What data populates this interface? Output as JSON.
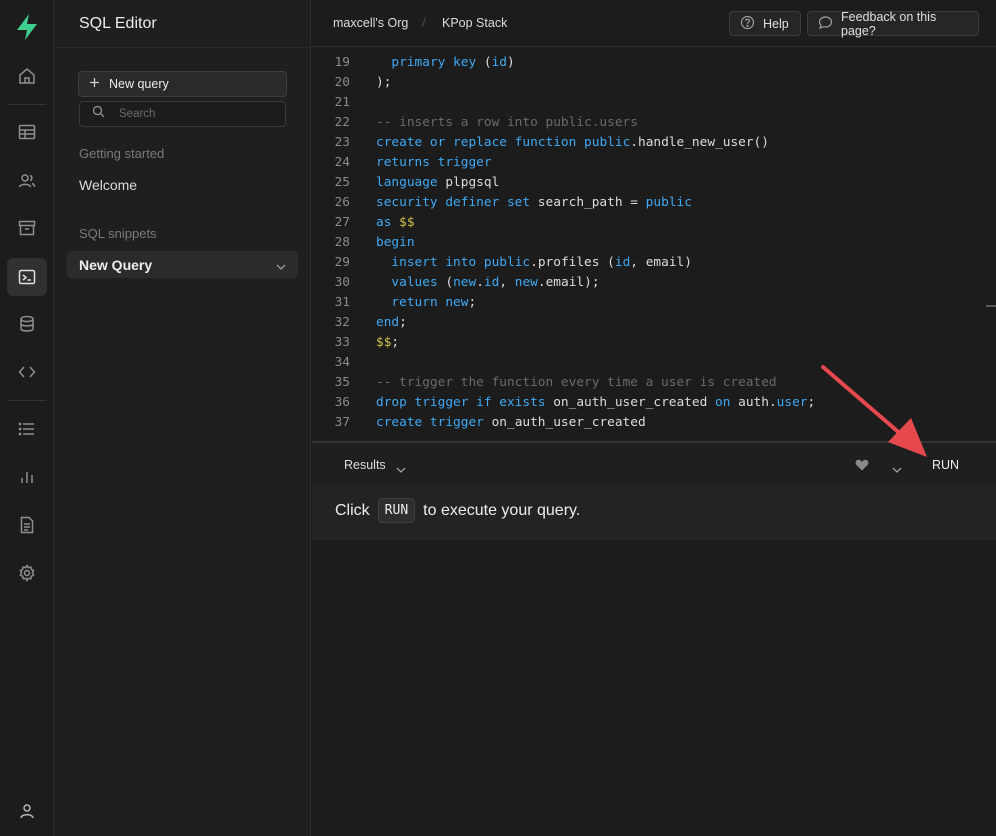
{
  "sidebar": {
    "title": "SQL Editor",
    "new_query_label": "New query",
    "search_placeholder": "Search",
    "section_getting_started": "Getting started",
    "welcome": "Welcome",
    "section_snippets": "SQL snippets",
    "active_query": "New Query"
  },
  "topbar": {
    "org": "maxcell's Org",
    "separator": "/",
    "project": "KPop Stack",
    "help_label": "Help",
    "feedback_label": "Feedback on this page?"
  },
  "editor": {
    "lines": [
      {
        "n": "19",
        "segs": [
          {
            "t": "  "
          },
          {
            "t": "primary key",
            "c": "kw"
          },
          {
            "t": " ("
          },
          {
            "t": "id",
            "c": "kw"
          },
          {
            "t": ")"
          }
        ]
      },
      {
        "n": "20",
        "segs": [
          {
            "t": ");"
          }
        ]
      },
      {
        "n": "21",
        "segs": []
      },
      {
        "n": "22",
        "segs": [
          {
            "t": "-- inserts a row into public.users",
            "c": "cm"
          }
        ]
      },
      {
        "n": "23",
        "segs": [
          {
            "t": "create or replace function",
            "c": "kw"
          },
          {
            "t": " "
          },
          {
            "t": "public",
            "c": "kw"
          },
          {
            "t": ".handle_new_user()"
          }
        ]
      },
      {
        "n": "24",
        "segs": [
          {
            "t": "returns trigger",
            "c": "kw"
          }
        ]
      },
      {
        "n": "25",
        "segs": [
          {
            "t": "language",
            "c": "kw"
          },
          {
            "t": " plpgsql"
          }
        ]
      },
      {
        "n": "26",
        "segs": [
          {
            "t": "security definer set",
            "c": "kw"
          },
          {
            "t": " search_path = "
          },
          {
            "t": "public",
            "c": "kw"
          }
        ]
      },
      {
        "n": "27",
        "segs": [
          {
            "t": "as",
            "c": "kw"
          },
          {
            "t": " "
          },
          {
            "t": "$$",
            "c": "dl"
          }
        ]
      },
      {
        "n": "28",
        "segs": [
          {
            "t": "begin",
            "c": "kw"
          }
        ]
      },
      {
        "n": "29",
        "segs": [
          {
            "t": "  "
          },
          {
            "t": "insert into",
            "c": "kw"
          },
          {
            "t": " "
          },
          {
            "t": "public",
            "c": "kw"
          },
          {
            "t": ".profiles ("
          },
          {
            "t": "id",
            "c": "kw"
          },
          {
            "t": ", email)"
          }
        ]
      },
      {
        "n": "30",
        "segs": [
          {
            "t": "  "
          },
          {
            "t": "values",
            "c": "kw"
          },
          {
            "t": " ("
          },
          {
            "t": "new",
            "c": "kw"
          },
          {
            "t": "."
          },
          {
            "t": "id",
            "c": "kw"
          },
          {
            "t": ", "
          },
          {
            "t": "new",
            "c": "kw"
          },
          {
            "t": ".email);"
          }
        ]
      },
      {
        "n": "31",
        "segs": [
          {
            "t": "  "
          },
          {
            "t": "return new",
            "c": "kw"
          },
          {
            "t": ";"
          }
        ]
      },
      {
        "n": "32",
        "segs": [
          {
            "t": "end",
            "c": "kw"
          },
          {
            "t": ";"
          }
        ]
      },
      {
        "n": "33",
        "segs": [
          {
            "t": "$$",
            "c": "dl"
          },
          {
            "t": ";"
          }
        ]
      },
      {
        "n": "34",
        "segs": []
      },
      {
        "n": "35",
        "segs": [
          {
            "t": "-- trigger the function every time a user is created",
            "c": "cm"
          }
        ]
      },
      {
        "n": "36",
        "segs": [
          {
            "t": "drop trigger if exists",
            "c": "kw"
          },
          {
            "t": " on_auth_user_created "
          },
          {
            "t": "on",
            "c": "kw"
          },
          {
            "t": " auth."
          },
          {
            "t": "user",
            "c": "kw"
          },
          {
            "t": ";"
          }
        ]
      },
      {
        "n": "37",
        "segs": [
          {
            "t": "create trigger",
            "c": "kw"
          },
          {
            "t": " on_auth_user_created"
          }
        ]
      }
    ]
  },
  "results": {
    "tab_label": "Results",
    "run_label": "RUN",
    "msg_before": "Click",
    "msg_kbd": "RUN",
    "msg_after": "to execute your query."
  },
  "colors": {
    "keyword": "#3fa9f5",
    "comment": "#6a6a6a",
    "dollar": "#d4c44a",
    "brand": "#3ecf8e",
    "annotation_arrow": "#e5484d"
  },
  "icons": [
    "supabase-logo-icon",
    "home-icon",
    "table-icon",
    "users-icon",
    "archive-icon",
    "terminal-icon",
    "database-icon",
    "code-icon",
    "list-icon",
    "chart-icon",
    "document-icon",
    "gear-icon",
    "user-icon",
    "search-icon",
    "plus-icon",
    "help-icon",
    "chat-icon",
    "chevron-down-icon",
    "heart-icon",
    "red-arrow-icon"
  ]
}
